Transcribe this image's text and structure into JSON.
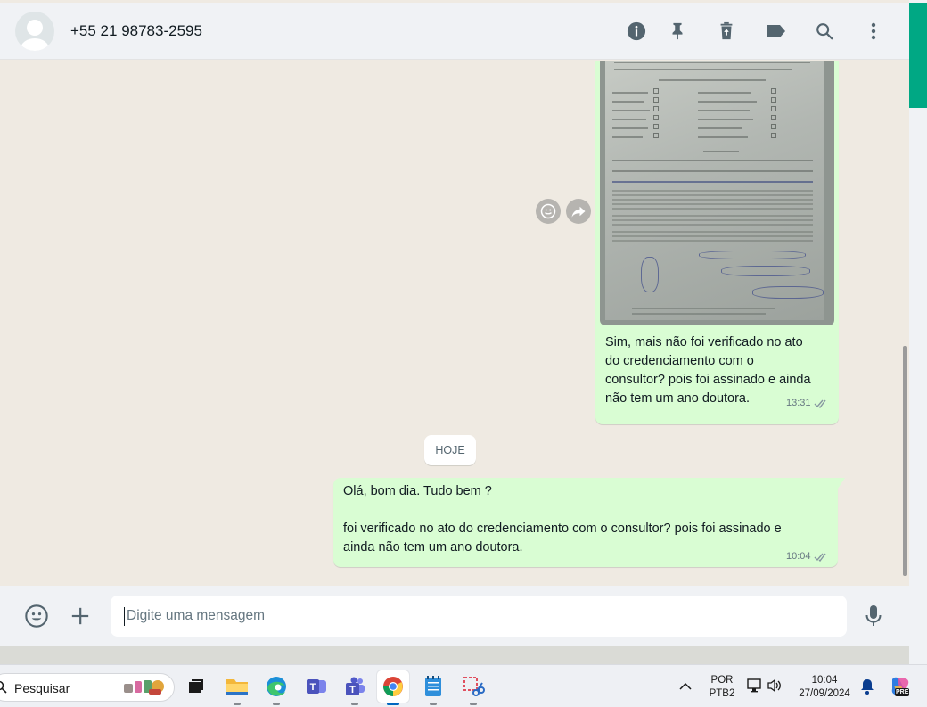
{
  "header": {
    "contact_name": "+55 21 98783-2595",
    "icons": [
      "info-icon",
      "pin-icon",
      "delete-icon",
      "label-icon",
      "search-icon",
      "more-icon"
    ]
  },
  "messages": [
    {
      "type": "image",
      "direction": "outgoing",
      "text_lines": [
        "Sim, mais não foi verificado no ato",
        "do credenciamento com o",
        "consultor? pois foi assinado e ainda",
        "não tem um ano doutora."
      ],
      "time": "13:31",
      "status": "read"
    },
    {
      "type": "date_separator",
      "label": "HOJE"
    },
    {
      "type": "text",
      "direction": "outgoing",
      "text_lines": [
        "Olá, bom dia. Tudo bem ?",
        "",
        "foi verificado no ato do credenciamento com o consultor? pois foi assinado e",
        "ainda não tem um ano doutora."
      ],
      "time": "10:04",
      "status": "read"
    }
  ],
  "composer": {
    "placeholder": "Digite uma mensagem"
  },
  "taskbar": {
    "search_label": "Pesquisar",
    "apps": [
      "task-view",
      "file-explorer",
      "edge",
      "teams-classic",
      "teams",
      "chrome",
      "notepad",
      "snipping-tool"
    ],
    "active_app": "chrome",
    "language_top": "POR",
    "language_bottom": "PTB2",
    "clock_time": "10:04",
    "clock_date": "27/09/2024",
    "copilot_badge": "PRE"
  },
  "colors": {
    "accent": "#00a884",
    "outgoing_bubble": "#d9fdd3",
    "chat_background": "#efeae2",
    "header_background": "#f0f2f5",
    "read_ticks": "#8696a0"
  }
}
